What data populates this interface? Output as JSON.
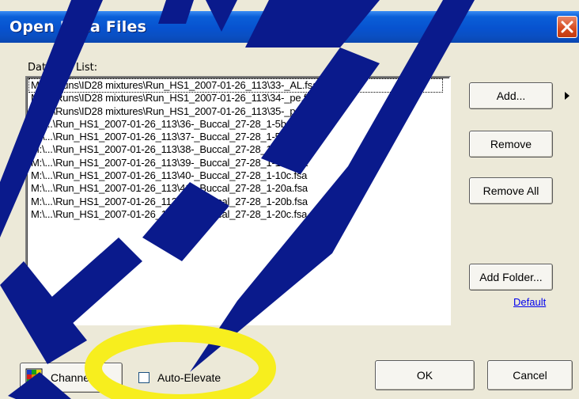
{
  "window": {
    "title": "Open Data Files",
    "close_icon": "close-icon"
  },
  "file_list": {
    "label": "Data File List:",
    "items": [
      "M:\\...\\Runs\\ID28 mixtures\\Run_HS1_2007-01-26_113\\33-_AL.fsa",
      "M:\\...\\Runs\\ID28 mixtures\\Run_HS1_2007-01-26_113\\34-_pe.fsa",
      "M:\\...\\Runs\\ID28 mixtures\\Run_HS1_2007-01-26_113\\35-_pe2.fsa",
      "M:\\...\\Run_HS1_2007-01-26_113\\36-_Buccal_27-28_1-5b.fsa",
      "M:\\...\\Run_HS1_2007-01-26_113\\37-_Buccal_27-28_1-5c.fsa",
      "M:\\...\\Run_HS1_2007-01-26_113\\38-_Buccal_27-28_1-10a.fsa",
      "M:\\...\\Run_HS1_2007-01-26_113\\39-_Buccal_27-28_1-10b.fsa",
      "M:\\...\\Run_HS1_2007-01-26_113\\40-_Buccal_27-28_1-10c.fsa",
      "M:\\...\\Run_HS1_2007-01-26_113\\41-_Buccal_27-28_1-20a.fsa",
      "M:\\...\\Run_HS1_2007-01-26_113\\42-_Buccal_27-28_1-20b.fsa",
      "M:\\...\\Run_HS1_2007-01-26_113\\43-_Buccal_27-28_1-20c.fsa"
    ]
  },
  "buttons": {
    "add": "Add...",
    "remove": "Remove",
    "remove_all": "Remove All",
    "add_folder": "Add Folder...",
    "default_link": "Default",
    "channels": "Channels...",
    "ok": "OK",
    "cancel": "Cancel"
  },
  "options": {
    "auto_elevate_label": "Auto-Elevate",
    "auto_elevate_checked": false
  },
  "colors": {
    "title_bar": "#0752cf",
    "close_button": "#d64a1e",
    "dialog_background": "#ece9d8",
    "link": "#0000ee",
    "annotation_highlight": "#f7ee1e",
    "watermark": "#0a1a8c"
  }
}
